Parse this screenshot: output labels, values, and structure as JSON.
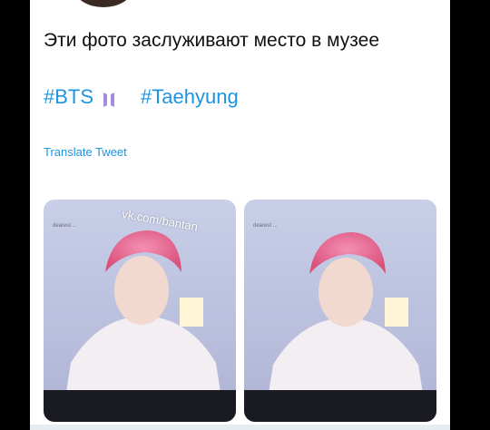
{
  "tweet": {
    "text": "Эти фото заслуживают место в музее",
    "hashtags": [
      {
        "label": "#BTS"
      },
      {
        "label": "#Taehyung"
      }
    ],
    "translate_label": "Translate Tweet"
  },
  "media": {
    "photos": [
      {
        "watermark": "vk.com/bantan",
        "caption": "dearest ... "
      },
      {
        "watermark": "",
        "caption": "dearest ... "
      }
    ]
  },
  "colors": {
    "link": "#1b95e0",
    "text": "#111111",
    "background": "#000000",
    "card": "#ffffff"
  },
  "icons": [
    "bts-logo-icon"
  ]
}
